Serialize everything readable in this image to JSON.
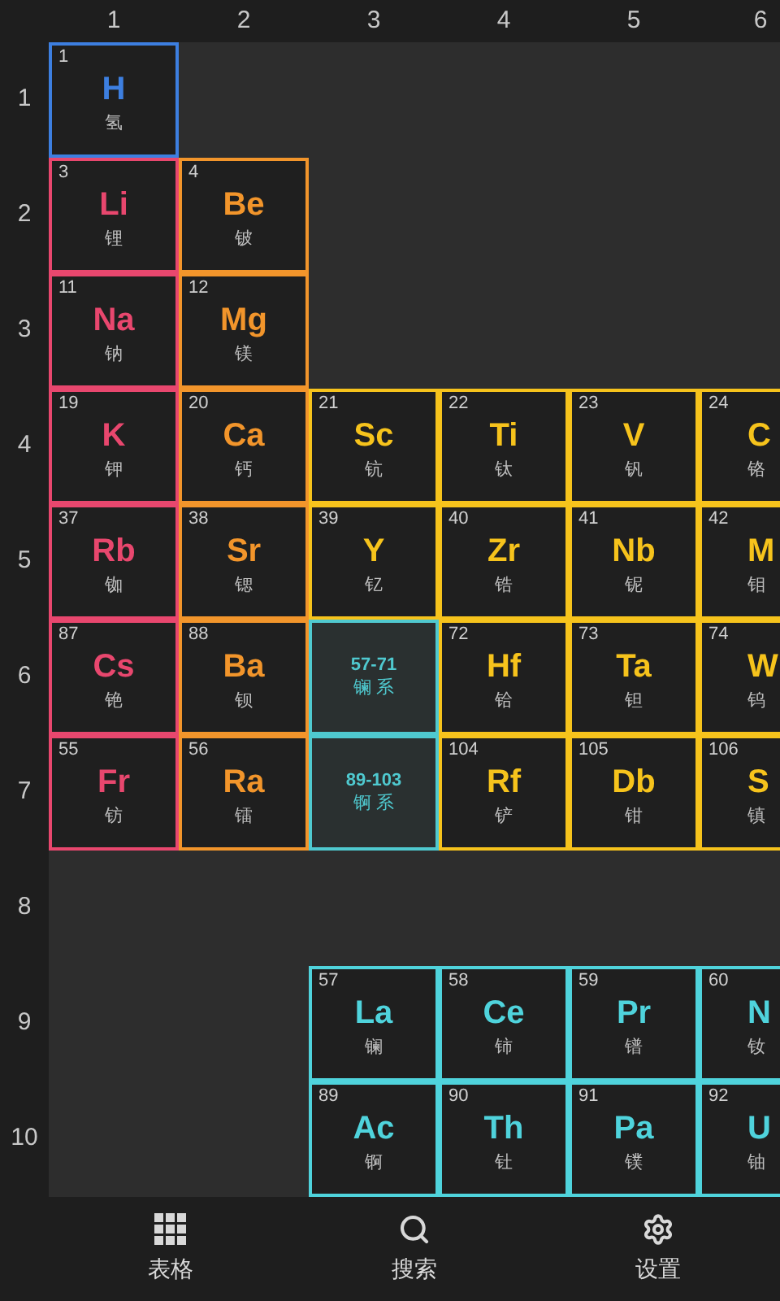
{
  "column_numbers": [
    "1",
    "2",
    "3",
    "4",
    "5",
    "6"
  ],
  "rows": [
    {
      "label": "1",
      "cells": [
        {
          "kind": "element",
          "number": "1",
          "symbol": "H",
          "name": "氢",
          "color": "#3d7fe0"
        },
        {
          "kind": "empty"
        },
        {
          "kind": "empty"
        },
        {
          "kind": "empty"
        },
        {
          "kind": "empty"
        },
        {
          "kind": "empty"
        }
      ]
    },
    {
      "label": "2",
      "cells": [
        {
          "kind": "element",
          "number": "3",
          "symbol": "Li",
          "name": "锂",
          "color": "#e8476e"
        },
        {
          "kind": "element",
          "number": "4",
          "symbol": "Be",
          "name": "铍",
          "color": "#f2952b"
        },
        {
          "kind": "empty"
        },
        {
          "kind": "empty"
        },
        {
          "kind": "empty"
        },
        {
          "kind": "empty"
        }
      ]
    },
    {
      "label": "3",
      "cells": [
        {
          "kind": "element",
          "number": "11",
          "symbol": "Na",
          "name": "钠",
          "color": "#e8476e"
        },
        {
          "kind": "element",
          "number": "12",
          "symbol": "Mg",
          "name": "镁",
          "color": "#f2952b"
        },
        {
          "kind": "empty"
        },
        {
          "kind": "empty"
        },
        {
          "kind": "empty"
        },
        {
          "kind": "empty"
        }
      ]
    },
    {
      "label": "4",
      "cells": [
        {
          "kind": "element",
          "number": "19",
          "symbol": "K",
          "name": "钾",
          "color": "#e8476e"
        },
        {
          "kind": "element",
          "number": "20",
          "symbol": "Ca",
          "name": "钙",
          "color": "#f2952b"
        },
        {
          "kind": "element",
          "number": "21",
          "symbol": "Sc",
          "name": "钪",
          "color": "#f6c31c"
        },
        {
          "kind": "element",
          "number": "22",
          "symbol": "Ti",
          "name": "钛",
          "color": "#f6c31c"
        },
        {
          "kind": "element",
          "number": "23",
          "symbol": "V",
          "name": "钒",
          "color": "#f6c31c"
        },
        {
          "kind": "element",
          "number": "24",
          "symbol": "C",
          "name": "铬",
          "color": "#f6c31c"
        }
      ]
    },
    {
      "label": "5",
      "cells": [
        {
          "kind": "element",
          "number": "37",
          "symbol": "Rb",
          "name": "铷",
          "color": "#e8476e"
        },
        {
          "kind": "element",
          "number": "38",
          "symbol": "Sr",
          "name": "锶",
          "color": "#f2952b"
        },
        {
          "kind": "element",
          "number": "39",
          "symbol": "Y",
          "name": "钇",
          "color": "#f6c31c"
        },
        {
          "kind": "element",
          "number": "40",
          "symbol": "Zr",
          "name": "锆",
          "color": "#f6c31c"
        },
        {
          "kind": "element",
          "number": "41",
          "symbol": "Nb",
          "name": "铌",
          "color": "#f6c31c"
        },
        {
          "kind": "element",
          "number": "42",
          "symbol": "M",
          "name": "钼",
          "color": "#f6c31c"
        }
      ]
    },
    {
      "label": "6",
      "cells": [
        {
          "kind": "element",
          "number": "87",
          "symbol": "Cs",
          "name": "铯",
          "color": "#e8476e"
        },
        {
          "kind": "element",
          "number": "88",
          "symbol": "Ba",
          "name": "钡",
          "color": "#f2952b"
        },
        {
          "kind": "series",
          "range": "57-71",
          "name": "镧 系",
          "color": "#4fc9cf"
        },
        {
          "kind": "element",
          "number": "72",
          "symbol": "Hf",
          "name": "铪",
          "color": "#f6c31c"
        },
        {
          "kind": "element",
          "number": "73",
          "symbol": "Ta",
          "name": "钽",
          "color": "#f6c31c"
        },
        {
          "kind": "element",
          "number": "74",
          "symbol": "W",
          "name": "钨",
          "color": "#f6c31c"
        }
      ]
    },
    {
      "label": "7",
      "cells": [
        {
          "kind": "element",
          "number": "55",
          "symbol": "Fr",
          "name": "钫",
          "color": "#e8476e"
        },
        {
          "kind": "element",
          "number": "56",
          "symbol": "Ra",
          "name": "镭",
          "color": "#f2952b"
        },
        {
          "kind": "series",
          "range": "89-103",
          "name": "锕 系",
          "color": "#4fc9cf"
        },
        {
          "kind": "element",
          "number": "104",
          "symbol": "Rf",
          "name": "铲",
          "color": "#f6c31c"
        },
        {
          "kind": "element",
          "number": "105",
          "symbol": "Db",
          "name": "钳",
          "color": "#f6c31c"
        },
        {
          "kind": "element",
          "number": "106",
          "symbol": "S",
          "name": "镇",
          "color": "#f6c31c"
        }
      ]
    },
    {
      "label": "8",
      "cells": [
        {
          "kind": "empty"
        },
        {
          "kind": "empty"
        },
        {
          "kind": "empty"
        },
        {
          "kind": "empty"
        },
        {
          "kind": "empty"
        },
        {
          "kind": "empty"
        }
      ]
    },
    {
      "label": "9",
      "cells": [
        {
          "kind": "empty"
        },
        {
          "kind": "empty"
        },
        {
          "kind": "element",
          "number": "57",
          "symbol": "La",
          "name": "镧",
          "color": "#4fd3dc"
        },
        {
          "kind": "element",
          "number": "58",
          "symbol": "Ce",
          "name": "铈",
          "color": "#4fd3dc"
        },
        {
          "kind": "element",
          "number": "59",
          "symbol": "Pr",
          "name": "镨",
          "color": "#4fd3dc"
        },
        {
          "kind": "element",
          "number": "60",
          "symbol": "N",
          "name": "钕",
          "color": "#4fd3dc"
        }
      ]
    },
    {
      "label": "10",
      "cells": [
        {
          "kind": "empty"
        },
        {
          "kind": "empty"
        },
        {
          "kind": "element",
          "number": "89",
          "symbol": "Ac",
          "name": "锕",
          "color": "#4fd3dc"
        },
        {
          "kind": "element",
          "number": "90",
          "symbol": "Th",
          "name": "钍",
          "color": "#4fd3dc"
        },
        {
          "kind": "element",
          "number": "91",
          "symbol": "Pa",
          "name": "镤",
          "color": "#4fd3dc"
        },
        {
          "kind": "element",
          "number": "92",
          "symbol": "U",
          "name": "铀",
          "color": "#4fd3dc"
        }
      ]
    }
  ],
  "nav": [
    {
      "kind": "grid",
      "label": "表格"
    },
    {
      "kind": "search",
      "label": "搜索"
    },
    {
      "kind": "settings",
      "label": "设置"
    }
  ]
}
